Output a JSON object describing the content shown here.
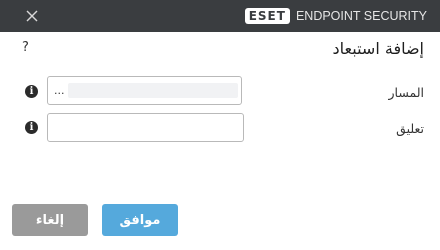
{
  "window": {
    "close_symbol": "✕",
    "brand_logo": "ESET",
    "product_name": "ENDPOINT SECURITY"
  },
  "dialog": {
    "title": "إضافة استبعاد",
    "help_symbol": "?"
  },
  "fields": {
    "path_label": "المسار",
    "path_browse": "...",
    "comment_label": "تعليق"
  },
  "icons": {
    "info_glyph": "i",
    "close": "close-icon",
    "help": "help-icon",
    "info": "info-icon"
  },
  "buttons": {
    "ok_label": "موافق",
    "cancel_label": "إلغاء"
  },
  "colors": {
    "titlebar": "#3a3d40",
    "brand_accent": "#2aa99b",
    "ok_button": "#55a9dc",
    "cancel_button": "#9a9a9a"
  }
}
